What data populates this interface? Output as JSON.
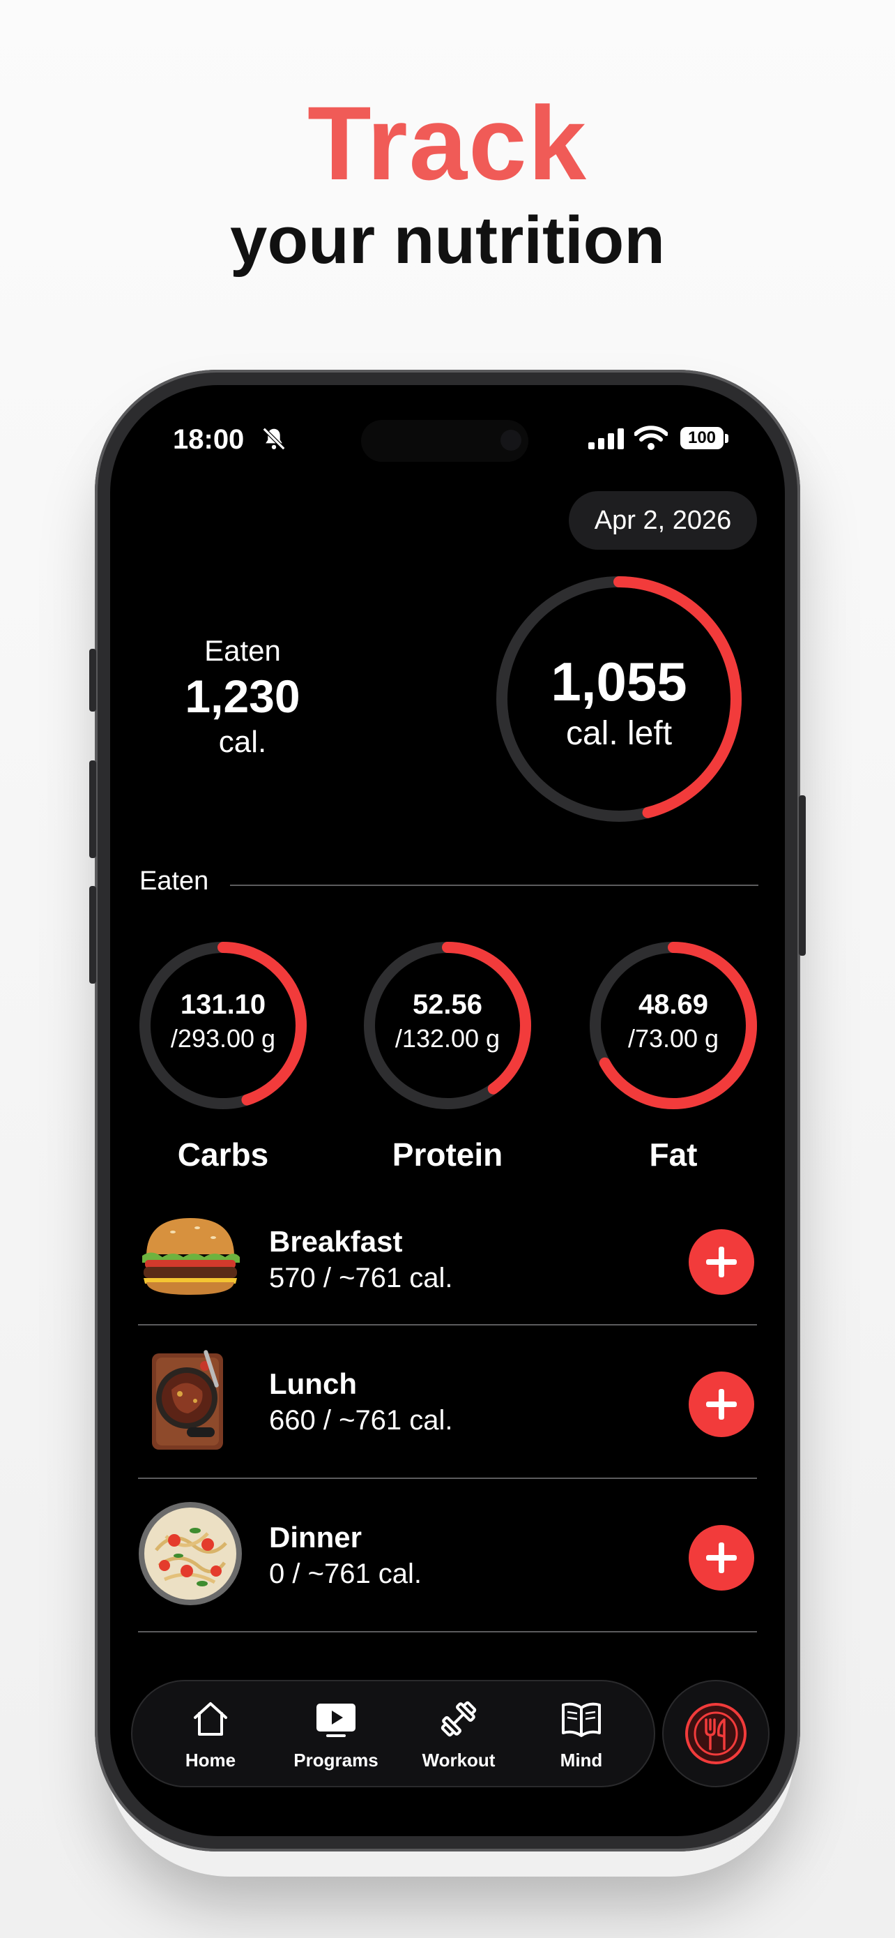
{
  "hero": {
    "title": "Track",
    "subtitle": "your nutrition"
  },
  "status_bar": {
    "time": "18:00",
    "battery": "100"
  },
  "date": "Apr 2, 2026",
  "summary": {
    "eaten_label": "Eaten",
    "eaten_value": "1,230",
    "eaten_unit": "cal.",
    "left_value": "1,055",
    "left_unit": "cal. left",
    "left_progress": 0.46
  },
  "section_label": "Eaten",
  "macros": [
    {
      "name": "Carbs",
      "value": "131.10",
      "goal": "/293.00 g",
      "progress": 0.45
    },
    {
      "name": "Protein",
      "value": "52.56",
      "goal": "/132.00 g",
      "progress": 0.4
    },
    {
      "name": "Fat",
      "value": "48.69",
      "goal": "/73.00 g",
      "progress": 0.67
    }
  ],
  "meals": [
    {
      "title": "Breakfast",
      "calories": "570 / ~761 cal."
    },
    {
      "title": "Lunch",
      "calories": "660 / ~761 cal."
    },
    {
      "title": "Dinner",
      "calories": "0 / ~761 cal."
    }
  ],
  "tabs": [
    {
      "label": "Home",
      "icon": "home-icon"
    },
    {
      "label": "Programs",
      "icon": "play-icon"
    },
    {
      "label": "Workout",
      "icon": "dumbbell-icon"
    },
    {
      "label": "Mind",
      "icon": "book-icon"
    }
  ],
  "colors": {
    "accent": "#f23b3b",
    "hero_title": "#f05b57",
    "ring_track": "#2e2e30"
  }
}
